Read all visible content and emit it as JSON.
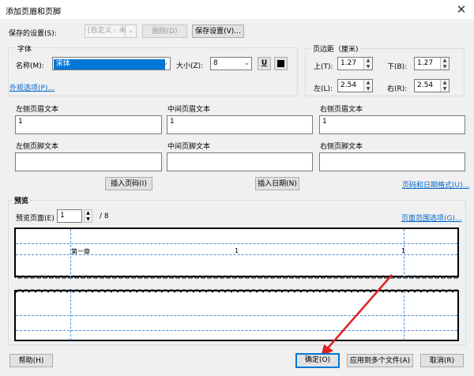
{
  "window": {
    "title": "添加页眉和页脚",
    "close_glyph": "✕"
  },
  "saved_settings": {
    "label": "保存的设置(S):",
    "value": "[自定义 - 未保存]",
    "delete_label": "删除(D)",
    "save_label": "保存设置(V)..."
  },
  "font": {
    "group_label": "字体",
    "name_label": "名称(M):",
    "name_value": "宋体",
    "size_label": "大小(Z):",
    "size_value": "8",
    "underline_glyph": "U",
    "color": "#000000"
  },
  "margins": {
    "group_label": "页边距（厘米)",
    "top_label": "上(T):",
    "top_value": "1.27",
    "bottom_label": "下(B):",
    "bottom_value": "1.27",
    "left_label": "左(L):",
    "left_value": "2.54",
    "right_label": "右(R):",
    "right_value": "2.54"
  },
  "appearance_link": "外观选项(P)...",
  "header": {
    "left_label": "左侧页眉文本",
    "left_value": "1",
    "center_label": "中间页眉文本",
    "center_value": "1",
    "right_label": "右侧页眉文本",
    "right_value": "1"
  },
  "footer": {
    "left_label": "左侧页脚文本",
    "left_value": "",
    "center_label": "中间页脚文本",
    "center_value": "",
    "right_label": "右侧页脚文本",
    "right_value": ""
  },
  "insert_page_label": "插入页码(I)",
  "insert_date_label": "插入日期(N)",
  "page_date_format_link": "页码和日期格式(U)...",
  "preview": {
    "group_label": "预览",
    "page_label": "预览页面(E)",
    "page_value": "1",
    "total_pages": "/ 8",
    "range_link": "页面范围选项(G)...",
    "sample_chapter": "第一章",
    "sample_center": "1",
    "sample_right": "1"
  },
  "footer_buttons": {
    "help": "帮助(H)",
    "ok": "确定(O)",
    "apply_multiple": "应用到多个文件(A)",
    "cancel": "取消(R)"
  },
  "colors": {
    "selection": "#0078d7",
    "link": "#0066cc",
    "guide": "#4a8fd9",
    "arrow": "#e02020"
  }
}
